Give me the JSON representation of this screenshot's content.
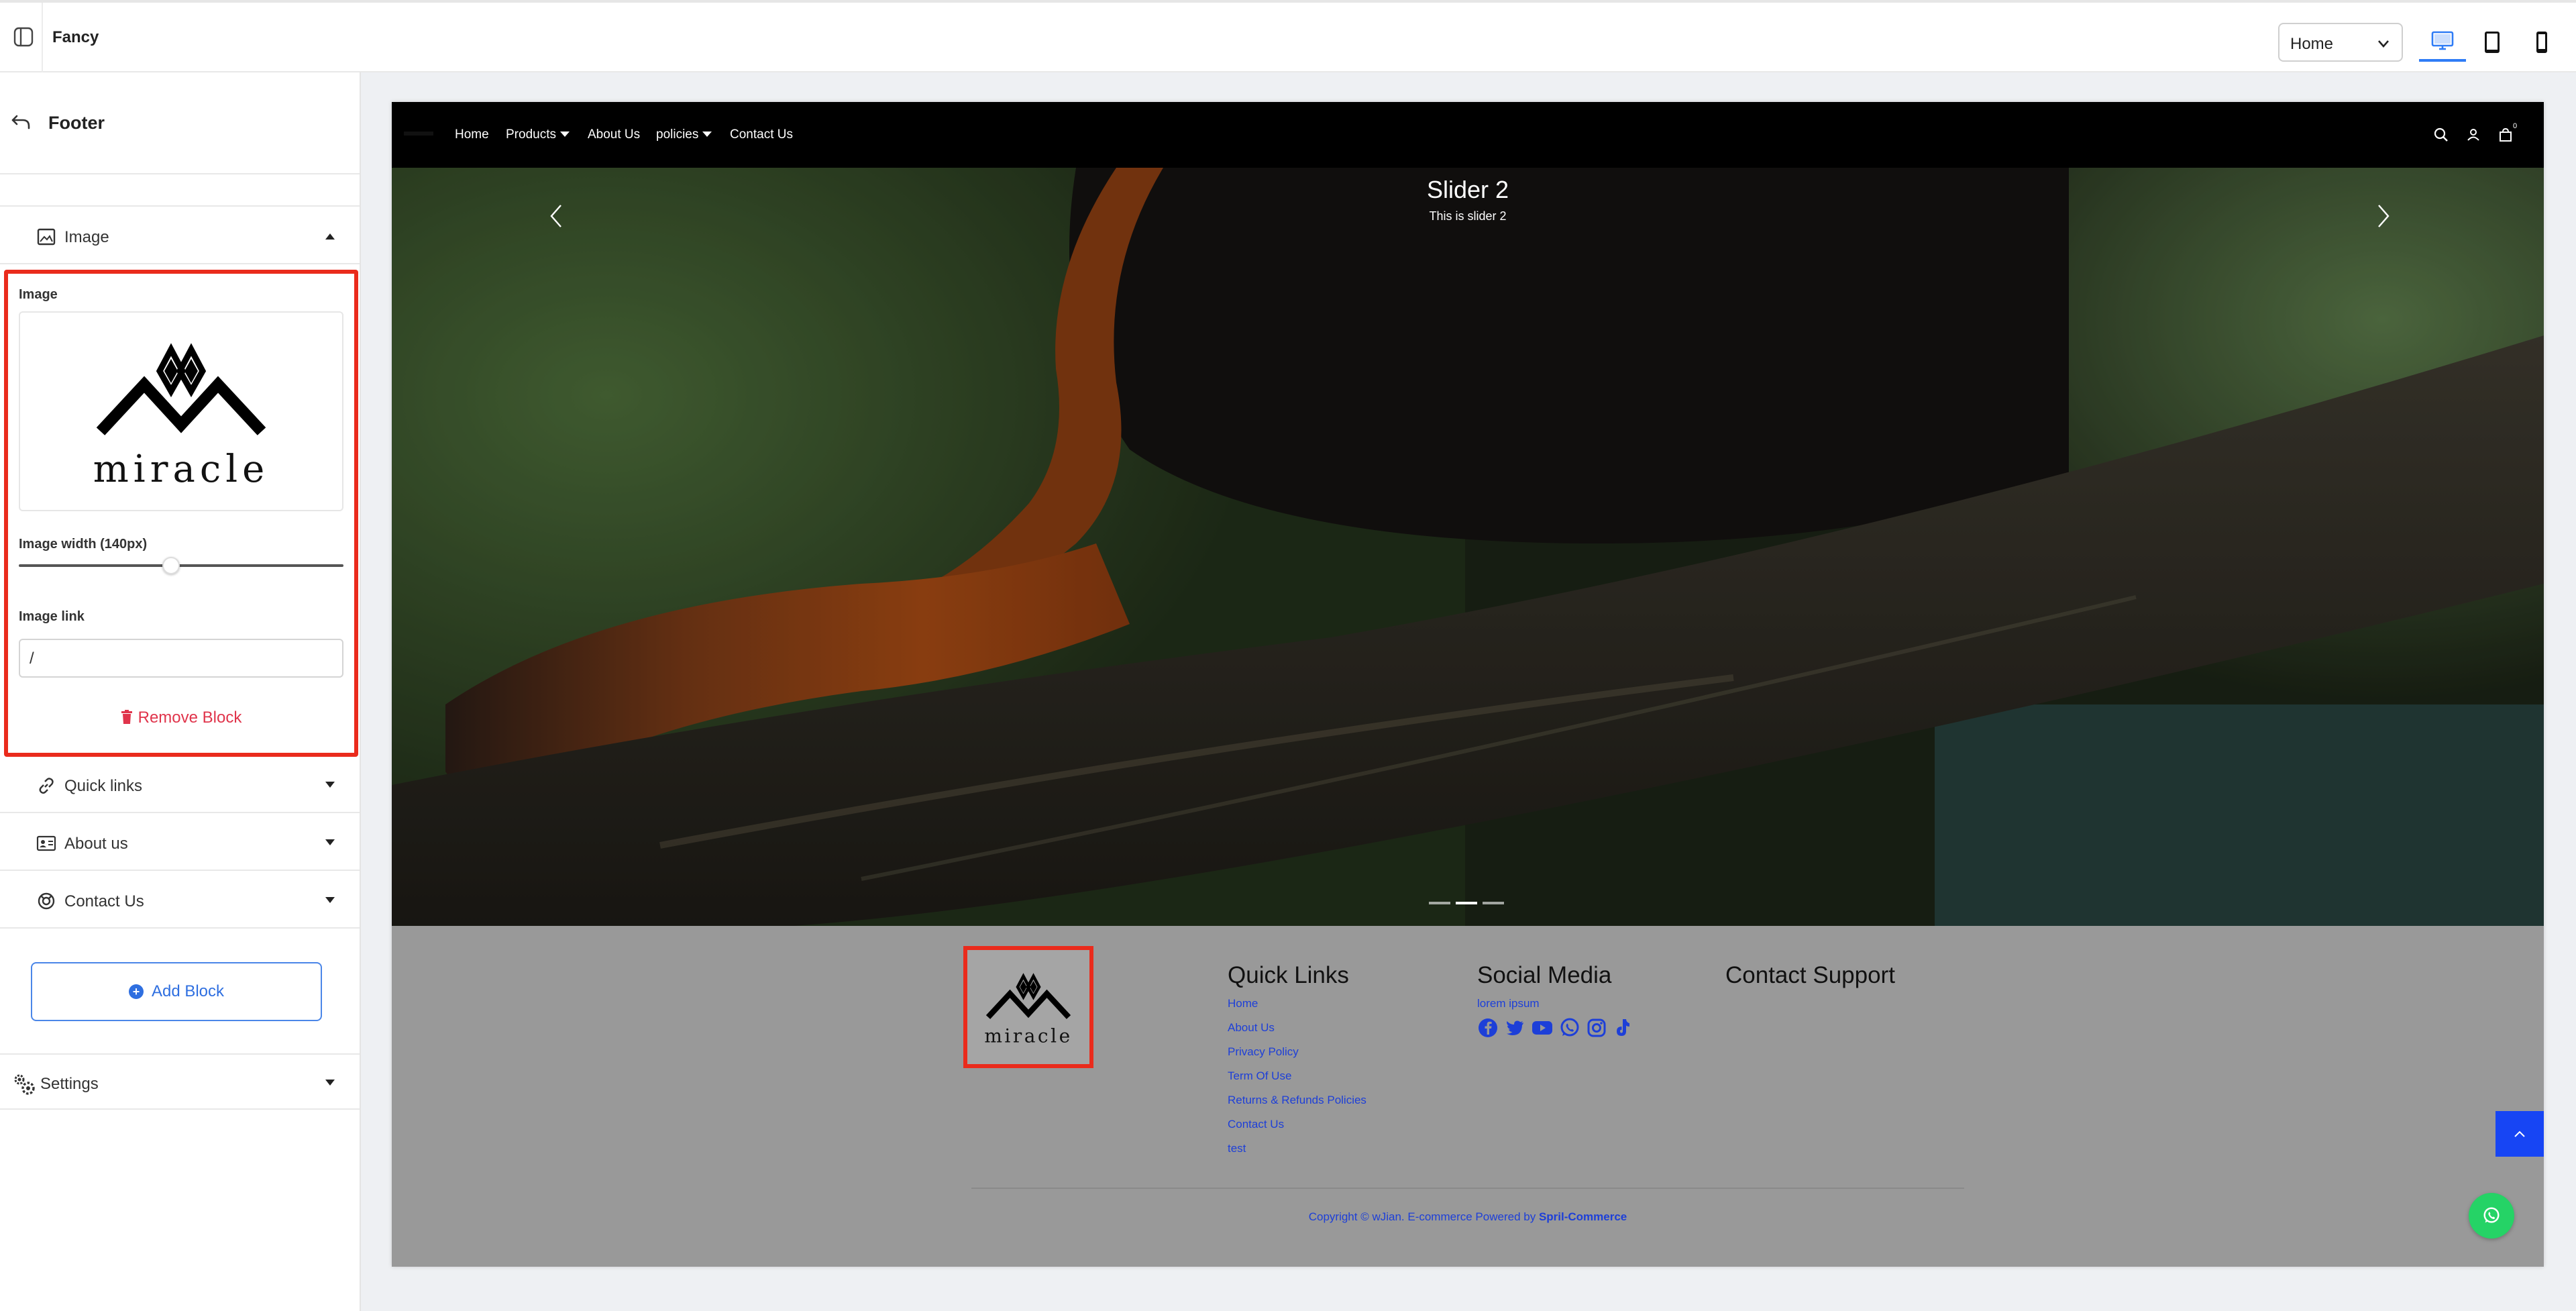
{
  "topbar": {
    "app_title": "Fancy",
    "page_select": "Home",
    "devices": [
      "desktop",
      "tablet",
      "mobile"
    ],
    "active_device": "desktop"
  },
  "sidebar": {
    "title": "Footer",
    "sections": {
      "image": {
        "label": "Image",
        "icon": "image-icon",
        "expanded": true
      },
      "quick_links": {
        "label": "Quick links",
        "icon": "link-icon"
      },
      "about_us": {
        "label": "About us",
        "icon": "id-card-icon"
      },
      "contact_us": {
        "label": "Contact Us",
        "icon": "support-icon"
      }
    },
    "block_editor": {
      "image_label": "Image",
      "image_alt": "miracle",
      "width_label": "Image width (140px)",
      "width_value": 140,
      "link_label": "Image link",
      "link_value": "/",
      "remove_label": "Remove Block"
    },
    "add_block_label": "Add Block",
    "settings_label": "Settings"
  },
  "preview": {
    "nav": {
      "items": [
        {
          "label": "Home",
          "dropdown": false
        },
        {
          "label": "Products",
          "dropdown": true
        },
        {
          "label": "About Us",
          "dropdown": false
        },
        {
          "label": "policies",
          "dropdown": true
        },
        {
          "label": "Contact Us",
          "dropdown": false
        }
      ],
      "cart_count": "0"
    },
    "hero": {
      "title": "Slider 2",
      "subtitle": "This is slider 2",
      "slide_count": 3,
      "active_slide": 2
    },
    "footer": {
      "logo_text": "miracle",
      "quick_links": {
        "heading": "Quick Links",
        "links": [
          "Home",
          "About Us",
          "Privacy Policy",
          "Term Of Use",
          "Returns & Refunds Policies",
          "Contact Us",
          "test"
        ]
      },
      "social": {
        "heading": "Social Media",
        "text": "lorem ipsum",
        "icons": [
          "facebook-icon",
          "twitter-icon",
          "youtube-icon",
          "whatsapp-icon",
          "instagram-icon",
          "tiktok-icon"
        ]
      },
      "contact": {
        "heading": "Contact Support"
      },
      "copyright": "Copyright © wJian. E-commerce Powered by",
      "powered_by": "Spril-Commerce"
    }
  },
  "colors": {
    "accent": "#2f7cf6",
    "highlight": "#ea2b1c",
    "remove": "#e0344b",
    "footer_bg": "#999999",
    "footer_link": "#1d3fd8",
    "to_top": "#1745f4",
    "whatsapp": "#25d366"
  }
}
